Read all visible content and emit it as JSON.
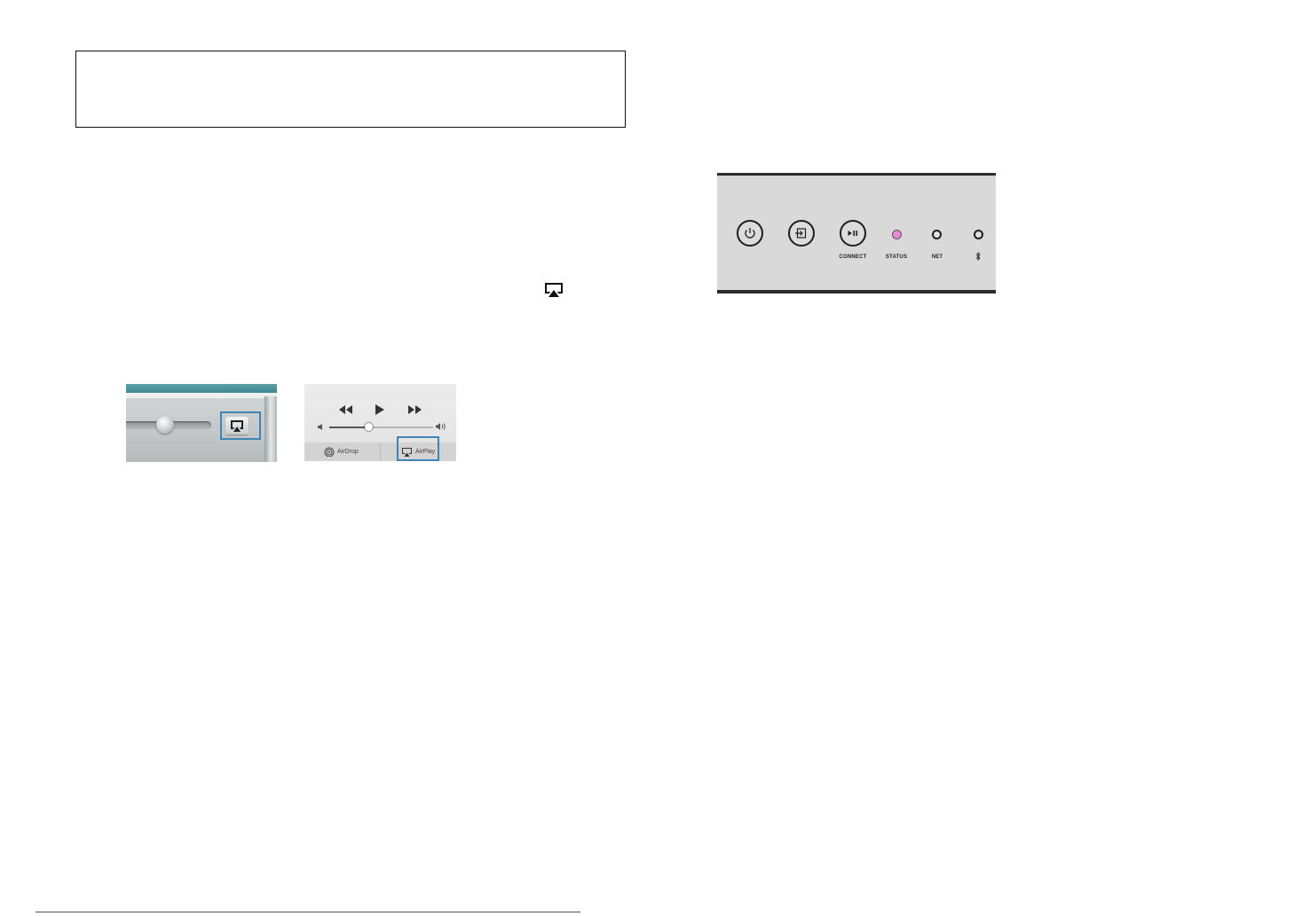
{
  "ios_controls": {
    "airdrop_label": "AirDrop",
    "airplay_label": "AirPlay",
    "volume_level": 0.38
  },
  "front_panel": {
    "connect_label": "CONNECT",
    "status_label": "STATUS",
    "net_label": "NET",
    "status_led_color": "#e98bd3",
    "bluetooth_symbol": "bluetooth-icon"
  },
  "colors": {
    "highlight": "#3c85b4",
    "panel_bg": "#d9d9d9"
  }
}
